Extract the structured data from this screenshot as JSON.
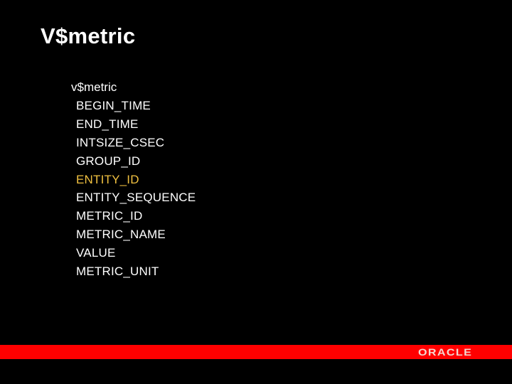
{
  "slide": {
    "title": "V$metric",
    "table_name": "v$metric",
    "columns": [
      {
        "label": "BEGIN_TIME",
        "highlighted": false
      },
      {
        "label": "END_TIME",
        "highlighted": false
      },
      {
        "label": "INTSIZE_CSEC",
        "highlighted": false
      },
      {
        "label": "GROUP_ID",
        "highlighted": false
      },
      {
        "label": "ENTITY_ID",
        "highlighted": true
      },
      {
        "label": "ENTITY_SEQUENCE",
        "highlighted": false
      },
      {
        "label": "METRIC_ID",
        "highlighted": false
      },
      {
        "label": "METRIC_NAME",
        "highlighted": false
      },
      {
        "label": "VALUE",
        "highlighted": false
      },
      {
        "label": "METRIC_UNIT",
        "highlighted": false
      }
    ],
    "highlight_color": "#f0c040",
    "text_color": "#ffffff",
    "background_color": "#000000"
  },
  "footer": {
    "bar_color": "#ff0000",
    "logo_text": "ORACLE"
  }
}
